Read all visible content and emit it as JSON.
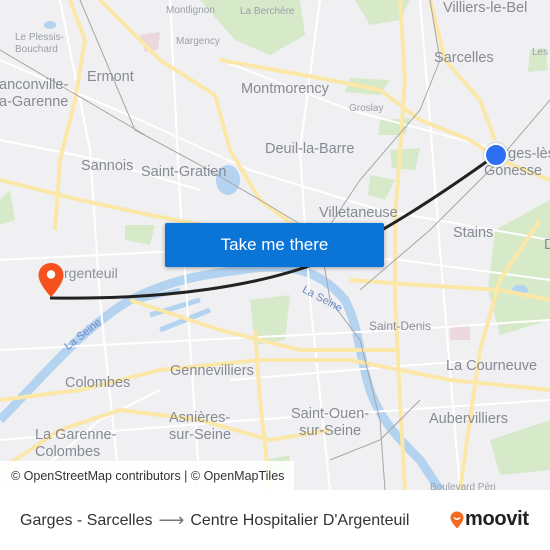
{
  "map": {
    "places": [
      {
        "id": "villiers-le-bel",
        "label": "Villiers-le-Bel",
        "size": "lg"
      },
      {
        "id": "montlignon",
        "label": "Montlignon",
        "size": "sm"
      },
      {
        "id": "la-berchere",
        "label": "La Berchère",
        "size": "sm"
      },
      {
        "id": "le-plessis-bouchard",
        "label": "Le Plessis-\nBouchard",
        "size": "sm"
      },
      {
        "id": "margency",
        "label": "Margency",
        "size": "sm"
      },
      {
        "id": "sarcelles",
        "label": "Sarcelles",
        "size": "lg"
      },
      {
        "id": "les",
        "label": "Les",
        "size": "sm"
      },
      {
        "id": "franconville",
        "label": "anconville-\na-Garenne",
        "size": "lg"
      },
      {
        "id": "ermont",
        "label": "Ermont",
        "size": "lg"
      },
      {
        "id": "montmorency",
        "label": "Montmorency",
        "size": "lg"
      },
      {
        "id": "groslay",
        "label": "Groslay",
        "size": "sm"
      },
      {
        "id": "garges",
        "label": "Garges-lès-\nGonesse",
        "size": "lg"
      },
      {
        "id": "sannois",
        "label": "Sannois",
        "size": "lg"
      },
      {
        "id": "saint-gratien",
        "label": "Saint-Gratien",
        "size": "lg"
      },
      {
        "id": "deuil-la-barre",
        "label": "Deuil-la-Barre",
        "size": "lg"
      },
      {
        "id": "villetaneuse",
        "label": "Villetaneuse",
        "size": "lg"
      },
      {
        "id": "stains",
        "label": "Stains",
        "size": "lg"
      },
      {
        "id": "d-east",
        "label": "D",
        "size": "lg"
      },
      {
        "id": "argenteuil",
        "label": "rgenteuil",
        "size": "md"
      },
      {
        "id": "saint-denis",
        "label": "Saint-Denis",
        "size": "md"
      },
      {
        "id": "gennevilliers",
        "label": "Gennevilliers",
        "size": "lg"
      },
      {
        "id": "la-courneuve",
        "label": "La Courneuve",
        "size": "lg"
      },
      {
        "id": "colombes",
        "label": "Colombes",
        "size": "lg"
      },
      {
        "id": "asnieres",
        "label": "Asnières-\nsur-Seine",
        "size": "lg"
      },
      {
        "id": "saint-ouen",
        "label": "Saint-Ouen-\nsur-Seine",
        "size": "lg"
      },
      {
        "id": "aubervilliers",
        "label": "Aubervilliers",
        "size": "lg"
      },
      {
        "id": "la-garenne-colombes",
        "label": "La Garenne-\nColombes",
        "size": "lg"
      },
      {
        "id": "boulevard",
        "label": "Boulevard Péri",
        "size": "sm"
      }
    ],
    "rivers": [
      {
        "id": "la-seine-west",
        "label": "La Seine"
      },
      {
        "id": "la-seine-center",
        "label": "La Seine"
      }
    ],
    "origin_marker": {
      "name": "Garges - Sarcelles",
      "color": "#2e6ff2"
    },
    "destination_marker": {
      "name": "Centre Hospitalier D'Argenteuil",
      "color": "#f4511e"
    },
    "route_line_color": "#222222"
  },
  "cta": {
    "label": "Take me there",
    "color": "#0b74d7"
  },
  "attribution": "© OpenStreetMap contributors | © OpenMapTiles",
  "footer": {
    "origin": "Garges - Sarcelles",
    "arrow": "⟶",
    "destination": "Centre Hospitalier D'Argenteuil",
    "brand": "moovit",
    "brand_color": "#f26b21"
  }
}
